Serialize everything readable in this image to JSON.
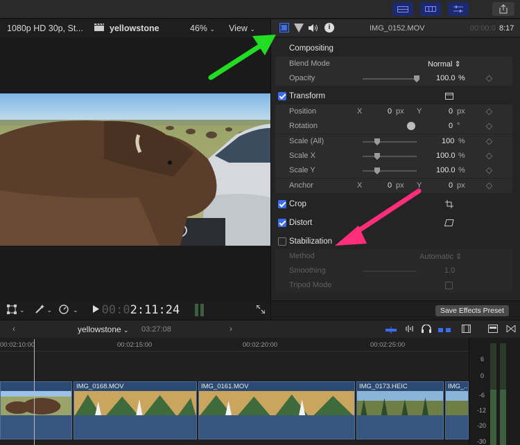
{
  "viewer": {
    "format": "1080p HD 30p, St...",
    "project_name": "yellowstone",
    "zoom": "46%",
    "view_label": "View",
    "timecode_dim": "00:0",
    "timecode": "2:11:24"
  },
  "inspector": {
    "clip_name": "IMG_0152.MOV",
    "duration_dim": "00:00:0",
    "duration": "8:17",
    "compositing": "Compositing",
    "blend_mode_label": "Blend Mode",
    "blend_mode_value": "Normal",
    "opacity_label": "Opacity",
    "opacity_value": "100.0",
    "opacity_unit": "%",
    "transform": "Transform",
    "position_label": "Position",
    "position_x_axis": "X",
    "position_x": "0",
    "position_x_unit": "px",
    "position_y_axis": "Y",
    "position_y": "0",
    "position_y_unit": "px",
    "rotation_label": "Rotation",
    "rotation_value": "0",
    "rotation_unit": "°",
    "scale_all_label": "Scale (All)",
    "scale_all_value": "100",
    "scale_all_unit": "%",
    "scale_x_label": "Scale X",
    "scale_x_value": "100.0",
    "scale_x_unit": "%",
    "scale_y_label": "Scale Y",
    "scale_y_value": "100.0",
    "scale_y_unit": "%",
    "anchor_label": "Anchor",
    "anchor_x_axis": "X",
    "anchor_x": "0",
    "anchor_x_unit": "px",
    "anchor_y_axis": "Y",
    "anchor_y": "0",
    "anchor_y_unit": "px",
    "crop": "Crop",
    "distort": "Distort",
    "stabilization": "Stabilization",
    "method_label": "Method",
    "method_value": "Automatic",
    "smoothing_label": "Smoothing",
    "smoothing_value": "1.0",
    "tripod_label": "Tripod Mode",
    "save_preset": "Save Effects Preset"
  },
  "timeline": {
    "project_name": "yellowstone",
    "duration": "03:27:08",
    "ruler": [
      "00:02:10:00",
      "00:02:15:00",
      "00:02:20:00",
      "00:02:25:00"
    ],
    "clips": [
      {
        "name": "",
        "color": "#2b4a73"
      },
      {
        "name": "IMG_0168.MOV",
        "color": "#2b4a73"
      },
      {
        "name": "IMG_0161.MOV",
        "color": "#2b4a73"
      },
      {
        "name": "IMG_0173.HEIC",
        "color": "#2b4a73"
      },
      {
        "name": "IMG_...",
        "color": "#2b4a73"
      }
    ]
  },
  "meters": {
    "scale": [
      "6",
      "0",
      "-6",
      "-12",
      "-20",
      "-30"
    ]
  },
  "annotations": {
    "green_arrow": "#22dd22",
    "pink_arrow": "#ff2e7a"
  },
  "colors": {
    "accent": "#3a6df0",
    "clip_blue": "#2b4a73"
  }
}
